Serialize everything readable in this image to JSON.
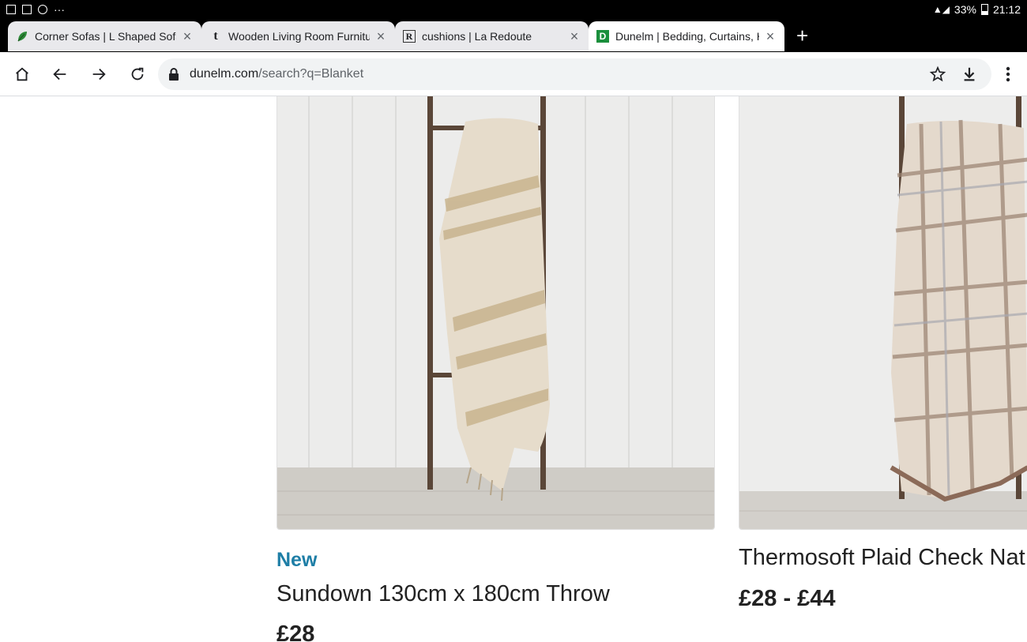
{
  "status_bar": {
    "icons_left": [
      "notification-icon",
      "image-icon",
      "sync-icon"
    ],
    "more": "···",
    "battery": "33%",
    "time": "21:12"
  },
  "tabs": [
    {
      "title": "Corner Sofas | L Shaped Sofa",
      "favicon_icon": "leaf-icon",
      "active": false
    },
    {
      "title": "Wooden Living Room Furniture",
      "favicon_icon": "t-icon",
      "favicon_text": "t",
      "active": false
    },
    {
      "title": "cushions | La Redoute",
      "favicon_icon": "r-icon",
      "favicon_text": "R",
      "active": false
    },
    {
      "title": "Dunelm | Bedding, Curtains, H",
      "favicon_icon": "d-icon",
      "favicon_text": "D",
      "active": true
    }
  ],
  "new_tab_label": "+",
  "toolbar": {
    "url_host": "dunelm.com",
    "url_path": "/search?q=Blanket"
  },
  "products": [
    {
      "badge": "New",
      "name": "Sundown 130cm x 180cm Throw",
      "price": "£28"
    },
    {
      "name": "Thermosoft Plaid Check Nat",
      "price": "£28 - £44"
    }
  ],
  "colors": {
    "accent_new": "#1e7ea6",
    "active_tab": "#ffffff",
    "inactive_tab": "#e9e9ec",
    "dunelm_green": "#1a8f3c"
  }
}
